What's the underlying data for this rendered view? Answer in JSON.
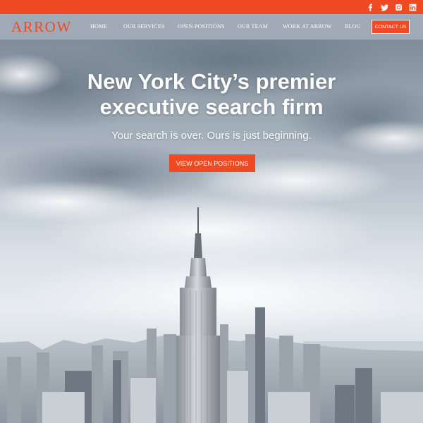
{
  "social": {
    "icons": [
      "facebook-icon",
      "twitter-icon",
      "instagram-icon",
      "linkedin-icon"
    ]
  },
  "brand": {
    "logo_text": "ARROW",
    "accent_color": "#f04a24"
  },
  "nav": {
    "items": [
      "HOME",
      "OUR SERVICES",
      "OPEN POSITIONS",
      "OUR TEAM",
      "WORK AT ARROW",
      "BLOG"
    ],
    "contact_label": "CONTACT US"
  },
  "hero": {
    "headline_line1": "New York City’s premier",
    "headline_line2": "executive search firm",
    "subline": "Your search is over. Ours is just beginning.",
    "cta_label": "VIEW OPEN POSITIONS"
  }
}
